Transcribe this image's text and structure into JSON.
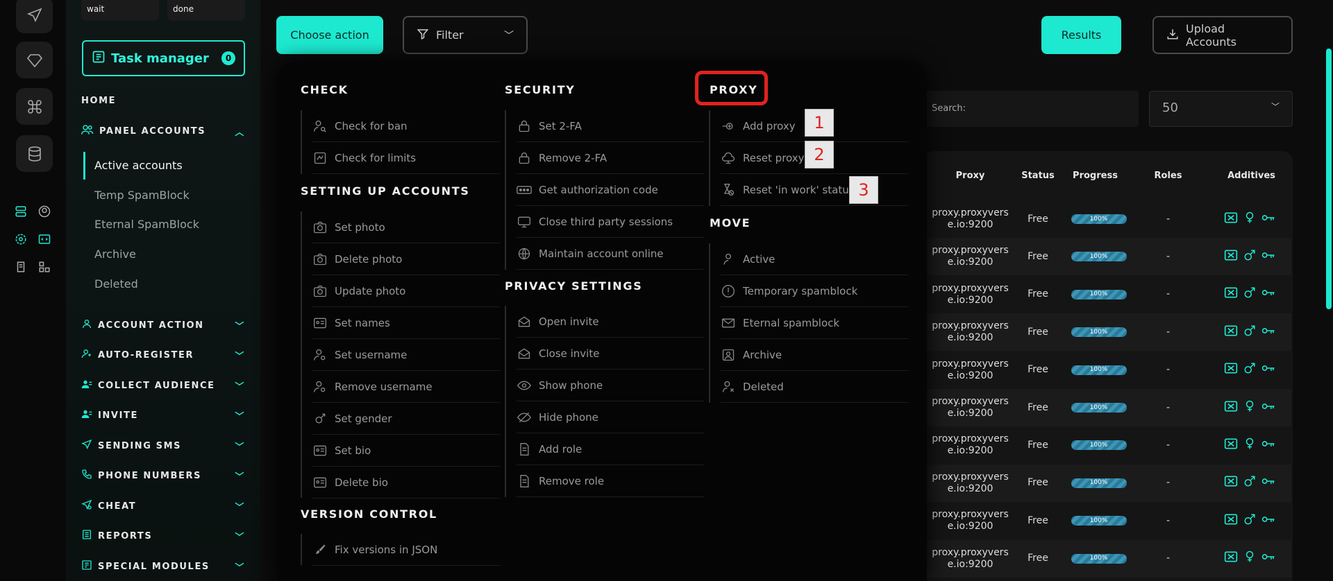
{
  "topbar": {
    "choose_action": "Choose action",
    "filter": "Filter",
    "results": "Results",
    "upload_accounts": "Upload Accounts",
    "search_placeholder": "Search:",
    "per_page": "50"
  },
  "sidebar": {
    "wait": "wait",
    "done": "done",
    "task_manager": "Task manager",
    "task_count": "0",
    "home": "HOME",
    "panel_accounts": "PANEL ACCOUNTS",
    "sub_items": [
      "Active accounts",
      "Temp SpamBlock",
      "Eternal SpamBlock",
      "Archive",
      "Deleted"
    ],
    "sections": [
      "ACCOUNT ACTION",
      "AUTO-REGISTER",
      "COLLECT AUDIENCE",
      "INVITE",
      "SENDING SMS",
      "PHONE NUMBERS",
      "CHEAT",
      "REPORTS",
      "SPECIAL MODULES"
    ]
  },
  "menu": {
    "check": {
      "title": "CHECK",
      "items": [
        "Check for ban",
        "Check for limits"
      ]
    },
    "setting_up": {
      "title": "SETTING UP ACCOUNTS",
      "items": [
        "Set photo",
        "Delete photo",
        "Update photo",
        "Set names",
        "Set username",
        "Remove username",
        "Set gender",
        "Set bio",
        "Delete bio"
      ]
    },
    "version_control": {
      "title": "VERSION CONTROL",
      "items": [
        "Fix versions in JSON"
      ]
    },
    "security": {
      "title": "SECURITY",
      "items": [
        "Set 2-FA",
        "Remove 2-FA",
        "Get authorization code",
        "Close third party sessions",
        "Maintain account online"
      ]
    },
    "privacy": {
      "title": "PRIVACY SETTINGS",
      "items": [
        "Open invite",
        "Close invite",
        "Show phone",
        "Hide phone",
        "Add role",
        "Remove role"
      ]
    },
    "proxy": {
      "title": "PROXY",
      "items": [
        "Add proxy",
        "Reset proxy",
        "Reset 'in work' status"
      ]
    },
    "move": {
      "title": "MOVE",
      "items": [
        "Active",
        "Temporary spamblock",
        "Eternal spamblock",
        "Archive",
        "Deleted"
      ]
    }
  },
  "annotations": [
    "1",
    "2",
    "3"
  ],
  "table": {
    "headers": [
      "Proxy",
      "Status",
      "Progress",
      "Roles",
      "Additives"
    ],
    "progress_percent": 100,
    "rows": [
      {
        "proxy1": "proxy.proxyvers",
        "proxy2": "e.io:9200",
        "status": "Free",
        "progress": "100%",
        "roles": "-",
        "gender": "female"
      },
      {
        "proxy1": "proxy.proxyvers",
        "proxy2": "e.io:9200",
        "status": "Free",
        "progress": "100%",
        "roles": "-",
        "gender": "male"
      },
      {
        "proxy1": "proxy.proxyvers",
        "proxy2": "e.io:9200",
        "status": "Free",
        "progress": "100%",
        "roles": "-",
        "gender": "male"
      },
      {
        "proxy1": "proxy.proxyvers",
        "proxy2": "e.io:9200",
        "status": "Free",
        "progress": "100%",
        "roles": "-",
        "gender": "male"
      },
      {
        "proxy1": "proxy.proxyvers",
        "proxy2": "e.io:9200",
        "status": "Free",
        "progress": "100%",
        "roles": "-",
        "gender": "male"
      },
      {
        "proxy1": "proxy.proxyvers",
        "proxy2": "e.io:9200",
        "status": "Free",
        "progress": "100%",
        "roles": "-",
        "gender": "female"
      },
      {
        "proxy1": "proxy.proxyvers",
        "proxy2": "e.io:9200",
        "status": "Free",
        "progress": "100%",
        "roles": "-",
        "gender": "female"
      },
      {
        "proxy1": "proxy.proxyvers",
        "proxy2": "e.io:9200",
        "status": "Free",
        "progress": "100%",
        "roles": "-",
        "gender": "male"
      },
      {
        "proxy1": "proxy.proxyvers",
        "proxy2": "e.io:9200",
        "status": "Free",
        "progress": "100%",
        "roles": "-",
        "gender": "male"
      },
      {
        "proxy1": "proxy.proxyvers",
        "proxy2": "e.io:9200",
        "status": "Free",
        "progress": "100%",
        "roles": "-",
        "gender": "female"
      }
    ]
  },
  "colors": {
    "accent": "#1de9d0",
    "highlight": "#e0231f"
  }
}
